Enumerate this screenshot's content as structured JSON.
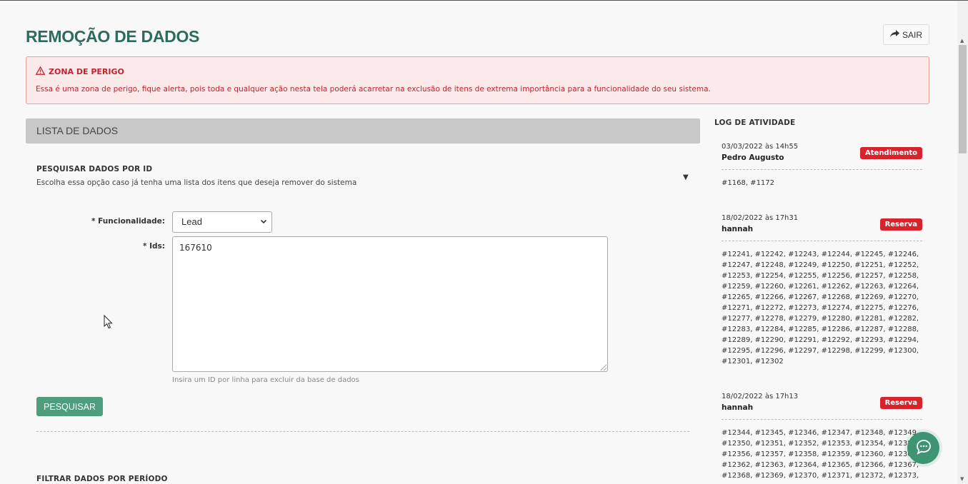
{
  "header": {
    "title": "REMOÇÃO DE DADOS",
    "exit_label": "SAIR"
  },
  "danger": {
    "title": "ZONA DE PERIGO",
    "text": "Essa é uma zona de perigo, fique alerta, pois toda e qualquer ação nesta tela poderá acarretar na exclusão de itens de extrema importância para a funcionalidade do seu sistema."
  },
  "list": {
    "header": "LISTA DE DADOS",
    "search": {
      "title": "PESQUISAR DADOS POR ID",
      "description": "Escolha essa opção caso já tenha uma lista dos itens que deseja remover do sistema",
      "funcionalidade_label": "* Funcionalidade:",
      "funcionalidade_value": "Lead",
      "ids_label": "* Ids:",
      "ids_value": "167610",
      "hint": "Insira um ID por linha para excluir da base de dados",
      "button_label": "PESQUISAR"
    },
    "filter_title": "FILTRAR DADOS POR PERÍODO"
  },
  "log": {
    "title": "LOG DE ATIVIDADE",
    "entries": [
      {
        "date": "03/03/2022 às 14h55",
        "user": "Pedro Augusto",
        "badge": "Atendimento",
        "ids": "#1168, #1172"
      },
      {
        "date": "18/02/2022 às 17h31",
        "user": "hannah",
        "badge": "Reserva",
        "ids": "#12241, #12242, #12243, #12244, #12245, #12246,\n#12247, #12248, #12249, #12250, #12251, #12252,\n#12253, #12254, #12255, #12256, #12257, #12258,\n#12259, #12260, #12261, #12262, #12263, #12264,\n#12265, #12266, #12267, #12268, #12269, #12270,\n#12271, #12272, #12273, #12274, #12275, #12276,\n#12277, #12278, #12279, #12280, #12281, #12282,\n#12283, #12284, #12285, #12286, #12287, #12288,\n#12289, #12290, #12291, #12292, #12293, #12294,\n#12295, #12296, #12297, #12298, #12299, #12300,\n#12301, #12302"
      },
      {
        "date": "18/02/2022 às 17h13",
        "user": "hannah",
        "badge": "Reserva",
        "ids": "#12344, #12345, #12346, #12347, #12348, #12349,\n#12350, #12351, #12352, #12353, #12354, #12355,\n#12356, #12357, #12358, #12359, #12360, #12361,\n#12362, #12363, #12364, #12365, #12366, #12367,\n#12368, #12369, #12370, #12371, #12372, #12373,"
      }
    ]
  },
  "icons": {
    "exit": "share-arrow-icon",
    "warning": "warning-triangle-icon",
    "chat": "chat-bubble-icon"
  },
  "colors": {
    "title": "#2e6b5e",
    "danger": "#c0242c",
    "badge": "#d9232b",
    "button": "#4e9e7d",
    "chat": "#3f9473"
  }
}
